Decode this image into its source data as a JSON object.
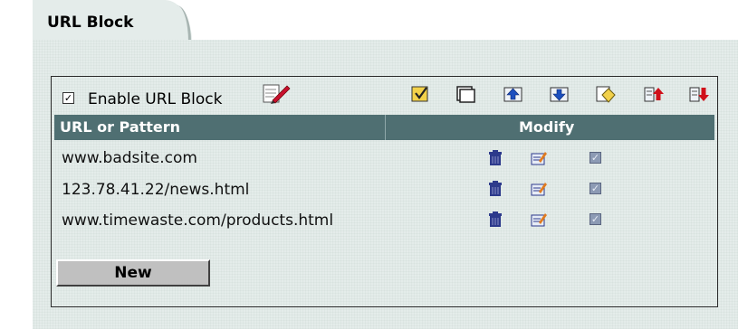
{
  "tab": {
    "title": "URL Block"
  },
  "toolbar": {
    "enable_label": "Enable URL Block",
    "enable_checked": true,
    "icons": [
      "check-all-icon",
      "clear-all-icon",
      "move-up-icon",
      "move-down-icon",
      "clear-list-icon",
      "import-icon",
      "export-icon"
    ]
  },
  "table": {
    "headers": [
      "URL or Pattern",
      "Modify"
    ],
    "rows": [
      {
        "url": "www.badsite.com",
        "enabled": true
      },
      {
        "url": "123.78.41.22/news.html",
        "enabled": true
      },
      {
        "url": "www.timewaste.com/products.html",
        "enabled": true
      }
    ]
  },
  "buttons": {
    "new_label": "New"
  },
  "colors": {
    "panel": "#e4ecea",
    "header": "#4f6f72",
    "action_icon": "#2d3a8c"
  }
}
